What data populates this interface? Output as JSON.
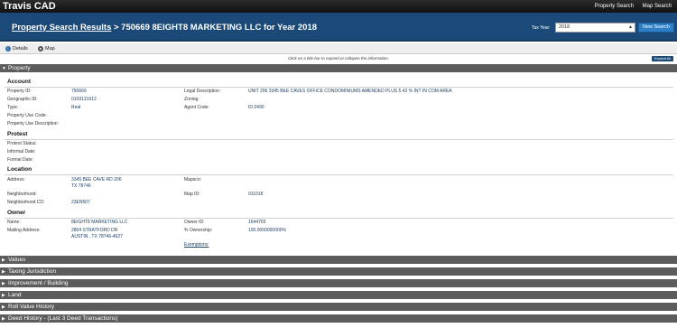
{
  "app": {
    "brand": "Travis CAD",
    "nav": [
      "Property Search",
      "Map Search"
    ]
  },
  "header": {
    "breadcrumb_link": "Property Search Results",
    "title_rest": " > 750669 8EIGHT8 MARKETING LLC for Year 2018",
    "tax_year_label": "Tax Year:",
    "tax_year_value": "2018",
    "new_search_label": "New Search"
  },
  "tabs": {
    "details": "Details",
    "map": "Map"
  },
  "hint": "Click on a title bar to expand or collapse the information.",
  "expand_all": "Expand All",
  "property": {
    "section_title": "Property",
    "account": {
      "heading": "Account",
      "property_id_label": "Property ID:",
      "property_id": "750669",
      "geographic_id_label": "Geographic ID:",
      "geographic_id": "0109131612",
      "type_label": "Type:",
      "type": "Real",
      "use_code_label": "Property Use Code:",
      "use_desc_label": "Property Use Description:",
      "legal_desc_label": "Legal Description:",
      "legal_desc": "UNIT 206 3345 BEE CAVES OFFICE CONDOMINIUMS AMENDED PLUS 5.42 % INT IN COM AREA",
      "zoning_label": "Zoning:",
      "agent_code_label": "Agent Code:",
      "agent_code": "ID:2490"
    },
    "protest": {
      "heading": "Protest",
      "status_label": "Protest Status:",
      "informal_label": "Informal Date:",
      "formal_label": "Formal Date:"
    },
    "location": {
      "heading": "Location",
      "address_label": "Address:",
      "address_line1": "3345 BEE CAVE RD 206",
      "address_line2": "TX 78746",
      "mapsco_label": "Mapsco:",
      "neighborhood_label": "Neighborhood:",
      "map_id_label": "Map ID:",
      "map_id": "011018",
      "neighborhood_cd_label": "Neighborhood CD:",
      "neighborhood_cd": "23EN507"
    },
    "owner": {
      "heading": "Owner",
      "name_label": "Name:",
      "name": "8EIGHT8 MARKETING LLC",
      "mailing_label": "Mailing Address:",
      "mailing_line1": "2804 STRATFORD DR",
      "mailing_line2": "AUSTIN , TX 78746-4627",
      "owner_id_label": "Owner ID:",
      "owner_id": "1644765",
      "ownership_label": "% Ownership:",
      "ownership": "100.0000000000%",
      "exemptions_label": "Exemptions:"
    }
  },
  "sections": [
    "Values",
    "Taxing Jurisdiction",
    "Improvement / Building",
    "Land",
    "Roll Value History",
    "Deed History - (Last 3 Deed Transactions)"
  ]
}
